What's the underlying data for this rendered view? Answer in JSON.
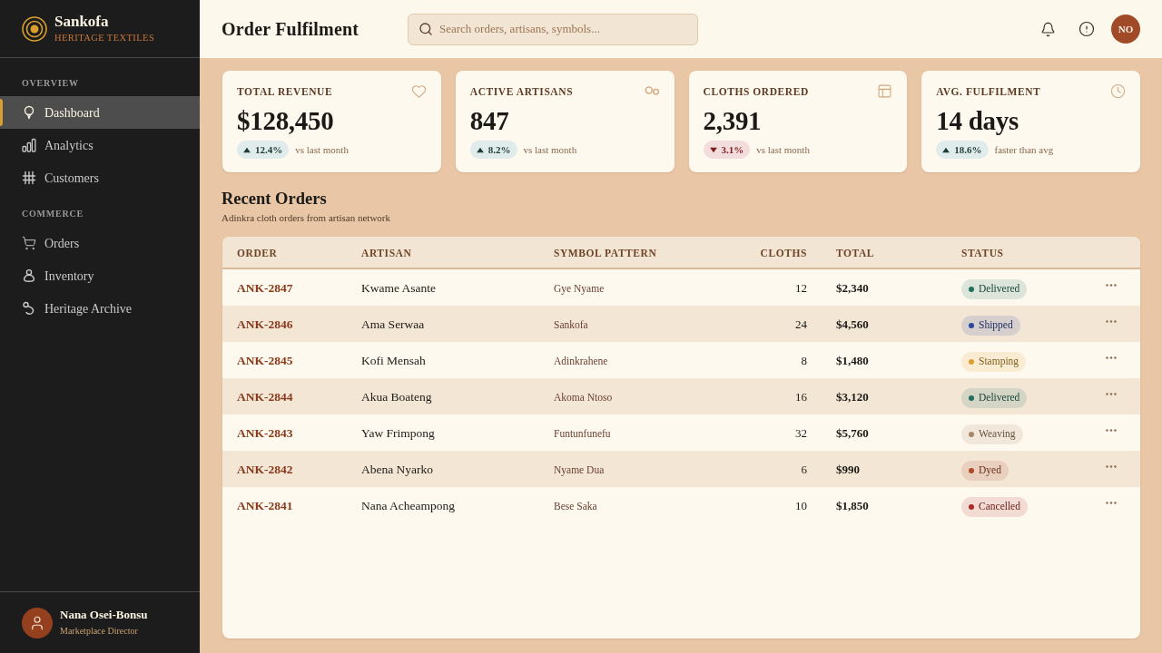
{
  "brand": {
    "name": "Sankofa",
    "tagline": "HERITAGE TEXTILES"
  },
  "sidebar": {
    "sections": [
      {
        "title": "OVERVIEW",
        "items": [
          {
            "label": "Dashboard",
            "selected": true
          },
          {
            "label": "Analytics",
            "selected": false
          },
          {
            "label": "Customers",
            "selected": false
          }
        ]
      },
      {
        "title": "COMMERCE",
        "items": [
          {
            "label": "Orders",
            "selected": false
          },
          {
            "label": "Inventory",
            "selected": false
          },
          {
            "label": "Heritage Archive",
            "selected": false
          }
        ]
      }
    ]
  },
  "user": {
    "name": "Nana Osei-Bonsu",
    "role": "Marketplace Director"
  },
  "header": {
    "title": "Order Fulfilment",
    "search": {
      "placeholder": "Search orders, artisans, symbols..."
    },
    "avatar_initials": "NO"
  },
  "stats": [
    {
      "label": "TOTAL REVENUE",
      "value": "$128,450",
      "kind": "up",
      "change": "12.4%",
      "note": "vs last month"
    },
    {
      "label": "ACTIVE ARTISANS",
      "value": "847",
      "kind": "up",
      "change": "8.2%",
      "note": "vs last month"
    },
    {
      "label": "CLOTHS ORDERED",
      "value": "2,391",
      "kind": "down",
      "change": "3.1%",
      "note": "vs last month"
    },
    {
      "label": "AVG. FULFILMENT",
      "value": "14 days",
      "kind": "up",
      "change": "18.6%",
      "note": "faster than avg"
    }
  ],
  "orders": {
    "title": "Recent Orders",
    "subtitle": "Adinkra cloth orders from artisan network",
    "columns": [
      "ORDER",
      "ARTISAN",
      "SYMBOL PATTERN",
      "CLOTHS",
      "TOTAL",
      "STATUS"
    ],
    "rows": [
      {
        "order": "ANK-2847",
        "artisan": "Kwame Asante",
        "pattern": "Gye Nyame",
        "cloths": "12",
        "total": "$2,340",
        "status": "Delivered",
        "color": "#1f7060"
      },
      {
        "order": "ANK-2846",
        "artisan": "Ama Serwaa",
        "pattern": "Sankofa",
        "cloths": "24",
        "total": "$4,560",
        "status": "Shipped",
        "color": "#2848a0"
      },
      {
        "order": "ANK-2845",
        "artisan": "Kofi Mensah",
        "pattern": "Adinkrahene",
        "cloths": "8",
        "total": "$1,480",
        "status": "Stamping",
        "color": "#e0a030"
      },
      {
        "order": "ANK-2844",
        "artisan": "Akua Boateng",
        "pattern": "Akoma Ntoso",
        "cloths": "16",
        "total": "$3,120",
        "status": "Delivered",
        "color": "#1f7060"
      },
      {
        "order": "ANK-2843",
        "artisan": "Yaw Frimpong",
        "pattern": "Funtunfunefu",
        "cloths": "32",
        "total": "$5,760",
        "status": "Weaving",
        "color": "#a88868"
      },
      {
        "order": "ANK-2842",
        "artisan": "Abena Nyarko",
        "pattern": "Nyame Dua",
        "cloths": "6",
        "total": "$990",
        "status": "Dyed",
        "color": "#b04a28"
      },
      {
        "order": "ANK-2841",
        "artisan": "Nana Acheampong",
        "pattern": "Bese Saka",
        "cloths": "10",
        "total": "$1,850",
        "status": "Cancelled",
        "color": "#b02828"
      }
    ]
  }
}
